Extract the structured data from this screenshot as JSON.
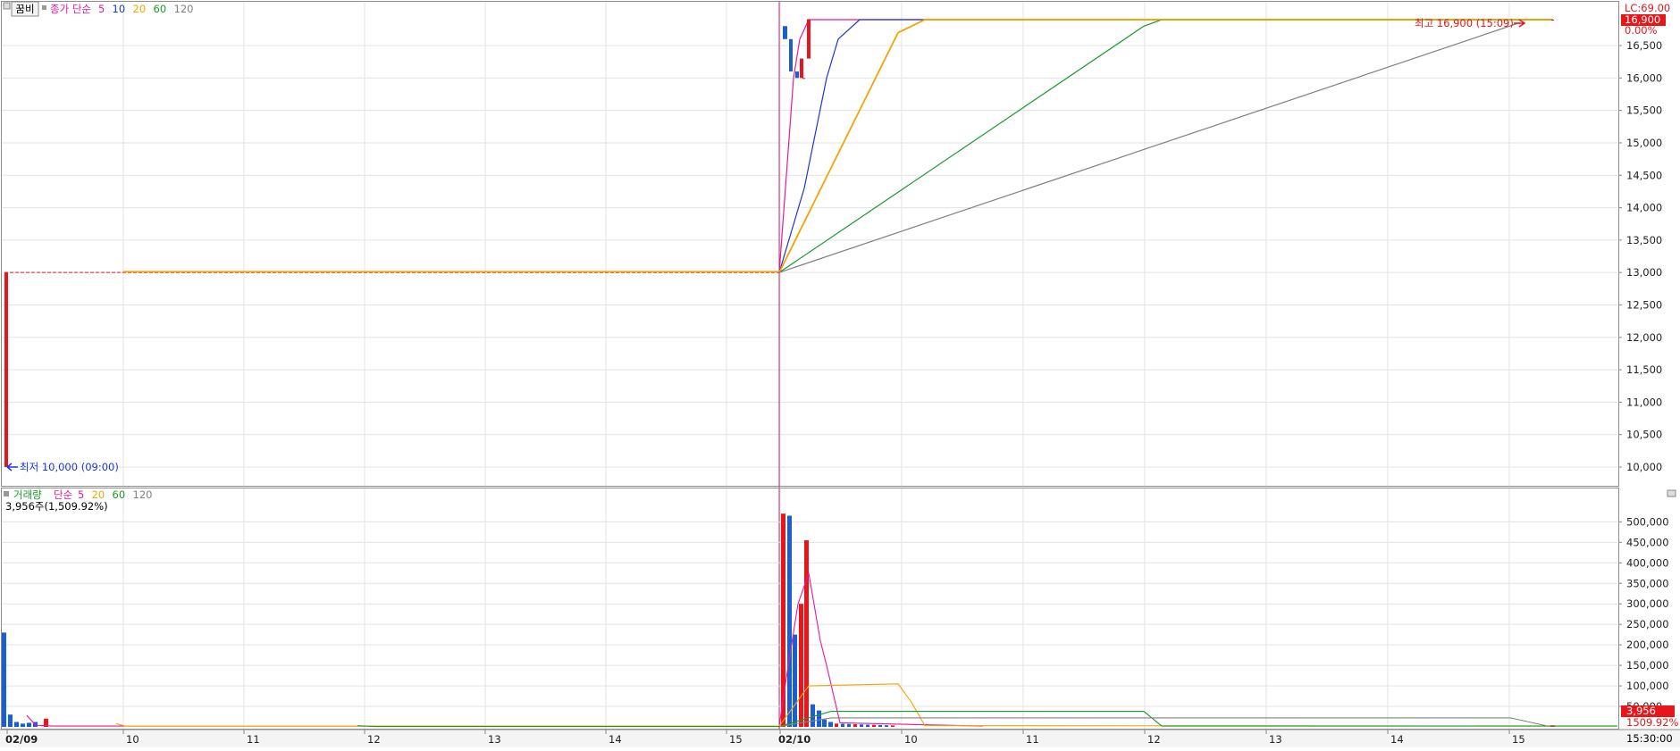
{
  "price_panel": {
    "toolbar": {
      "button_label": "꿈비",
      "legend_title": "종가 단순",
      "legend_periods": [
        "5",
        "10",
        "20",
        "60",
        "120"
      ],
      "legend_colors": [
        "#e8189a",
        "#1a35d8",
        "#f5a300",
        "#1a9a2a",
        "#808080"
      ]
    },
    "lc_label": "LC:69.00",
    "current_price_tag": "16,900",
    "current_change_tag": "0.00%",
    "high_annotation": "최고 16,900 (15:09)",
    "low_annotation": "최저 10,000 (09:00)",
    "y_ticks": [
      "16,500",
      "16,000",
      "15,500",
      "15,000",
      "14,500",
      "14,000",
      "13,500",
      "13,000",
      "12,500",
      "12,000",
      "11,500",
      "11,000",
      "10,500",
      "10,000"
    ]
  },
  "volume_panel": {
    "legend_title": "거래량",
    "legend_label": "단순",
    "legend_periods": [
      "5",
      "20",
      "60",
      "120"
    ],
    "legend_colors": [
      "#e8189a",
      "#f5a300",
      "#1a9a2a",
      "#808080"
    ],
    "volume_readout": "3,956주(1,509.92%)",
    "y_ticks": [
      "500,000",
      "450,000",
      "400,000",
      "350,000",
      "300,000",
      "250,000",
      "200,000",
      "150,000",
      "100,000",
      "50,000"
    ],
    "current_volume_tag": "3,956",
    "current_ratio_tag": "1509.92%"
  },
  "x_axis": {
    "labels": [
      "02/09",
      "10",
      "11",
      "12",
      "13",
      "14",
      "15",
      "02/10",
      "10",
      "11",
      "12",
      "13",
      "14",
      "15"
    ],
    "time_readout": "15:30:00"
  },
  "colors": {
    "up": "#e8161b",
    "down": "#1a5fd0",
    "ma5": "#e8189a",
    "ma10": "#1a35d8",
    "ma20": "#f5a300",
    "ma60": "#1a9a2a",
    "ma120": "#808080",
    "close_line": "#e8161b"
  },
  "chart_data": [
    {
      "type": "candlestick",
      "title": "꿈비",
      "x": [
        "02/09 09:00",
        "02/10 09:00",
        "02/10 09:01",
        "02/10 09:02",
        "02/10 09:03",
        "02/10 09:04",
        "02/10 09:05",
        "02/10 15:30"
      ],
      "open": [
        10000,
        16800,
        16600,
        16100,
        16000,
        16000,
        16300,
        16900
      ],
      "high": 16900,
      "low": 10000,
      "close": [
        13000,
        16600,
        16100,
        16000,
        16300,
        16000,
        16900,
        16900
      ],
      "series": [
        {
          "name": "5",
          "values_note": "moving average"
        },
        {
          "name": "10"
        },
        {
          "name": "20"
        },
        {
          "name": "60"
        },
        {
          "name": "120"
        }
      ],
      "ylim": [
        9800,
        16900
      ],
      "previous_close": 13000
    },
    {
      "type": "bar",
      "title": "거래량",
      "x": [
        "02/09 09:00",
        "02/09 09:05",
        "02/09 09:10",
        "02/09 09:15",
        "02/09 09:20",
        "02/09 09:25",
        "02/09 09:30",
        "02/10 09:00",
        "02/10 09:01",
        "02/10 09:02",
        "02/10 09:03",
        "02/10 09:04",
        "02/10 09:05",
        "02/10 09:06",
        "02/10 09:07",
        "02/10 09:08",
        "02/10 15:30"
      ],
      "values": [
        230000,
        30000,
        12000,
        8000,
        10000,
        12000,
        20000,
        520000,
        515000,
        225000,
        300000,
        455000,
        55000,
        40000,
        18000,
        12000,
        3956
      ],
      "ylim": [
        0,
        540000
      ],
      "last_volume": 3956,
      "last_ratio_percent": 1509.92
    }
  ]
}
